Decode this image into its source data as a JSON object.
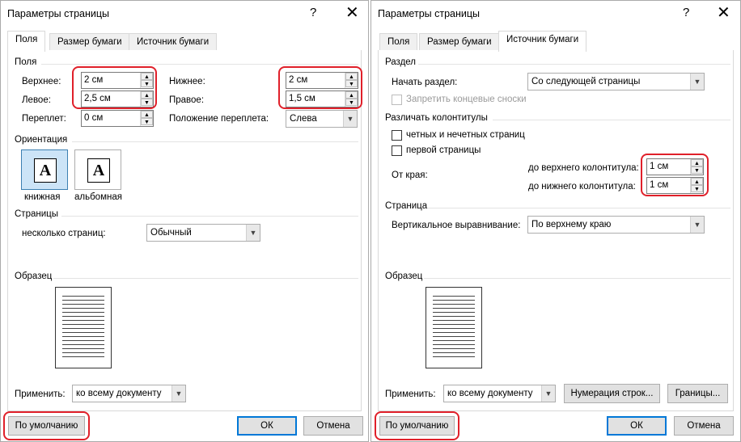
{
  "left": {
    "title": "Параметры страницы",
    "help": "?",
    "close": "✕",
    "tabs": [
      "Поля",
      "Размер бумаги",
      "Источник бумаги"
    ],
    "fields_section": "Поля",
    "top_label": "Верхнее:",
    "top_value": "2 см",
    "bottom_label": "Нижнее:",
    "bottom_value": "2 см",
    "left_label": "Левое:",
    "left_value": "2,5 см",
    "right_label": "Правое:",
    "right_value": "1,5 см",
    "gutter_label": "Переплет:",
    "gutter_value": "0 см",
    "gutter_pos_label": "Положение переплета:",
    "gutter_pos_value": "Слева",
    "orientation_section": "Ориентация",
    "portrait": "книжная",
    "landscape": "альбомная",
    "glyph": "A",
    "pages_section": "Страницы",
    "multiple_pages_label": "несколько страниц:",
    "multiple_pages_value": "Обычный",
    "sample_section": "Образец",
    "apply_label": "Применить:",
    "apply_value": "ко всему документу",
    "default_btn": "По умолчанию",
    "ok_btn": "ОК",
    "cancel_btn": "Отмена"
  },
  "right": {
    "title": "Параметры страницы",
    "help": "?",
    "close": "✕",
    "tabs": [
      "Поля",
      "Размер бумаги",
      "Источник бумаги"
    ],
    "section_section": "Раздел",
    "section_start_label": "Начать раздел:",
    "section_start_value": "Со следующей страницы",
    "suppress_endnotes": "Запретить концевые сноски",
    "headers_section": "Различать колонтитулы",
    "odd_even": "четных и нечетных страниц",
    "first_page": "первой страницы",
    "from_edge": "От края:",
    "header_label": "до верхнего колонтитула:",
    "header_value": "1 см",
    "footer_label": "до нижнего колонтитула:",
    "footer_value": "1 см",
    "page_section": "Страница",
    "valign_label": "Вертикальное выравнивание:",
    "valign_value": "По верхнему краю",
    "sample_section": "Образец",
    "apply_label": "Применить:",
    "apply_value": "ко всему документу",
    "line_numbers_btn": "Нумерация строк...",
    "borders_btn": "Границы...",
    "default_btn": "По умолчанию",
    "ok_btn": "ОК",
    "cancel_btn": "Отмена"
  },
  "colors": {
    "highlight_red": "#e0202a",
    "accent_blue": "#0078d7",
    "selected_bg": "#cce4f7"
  },
  "icons": {
    "spin_up": "▲",
    "spin_down": "▼",
    "dropdown": "▼",
    "close": "close-icon",
    "help": "help-icon"
  }
}
